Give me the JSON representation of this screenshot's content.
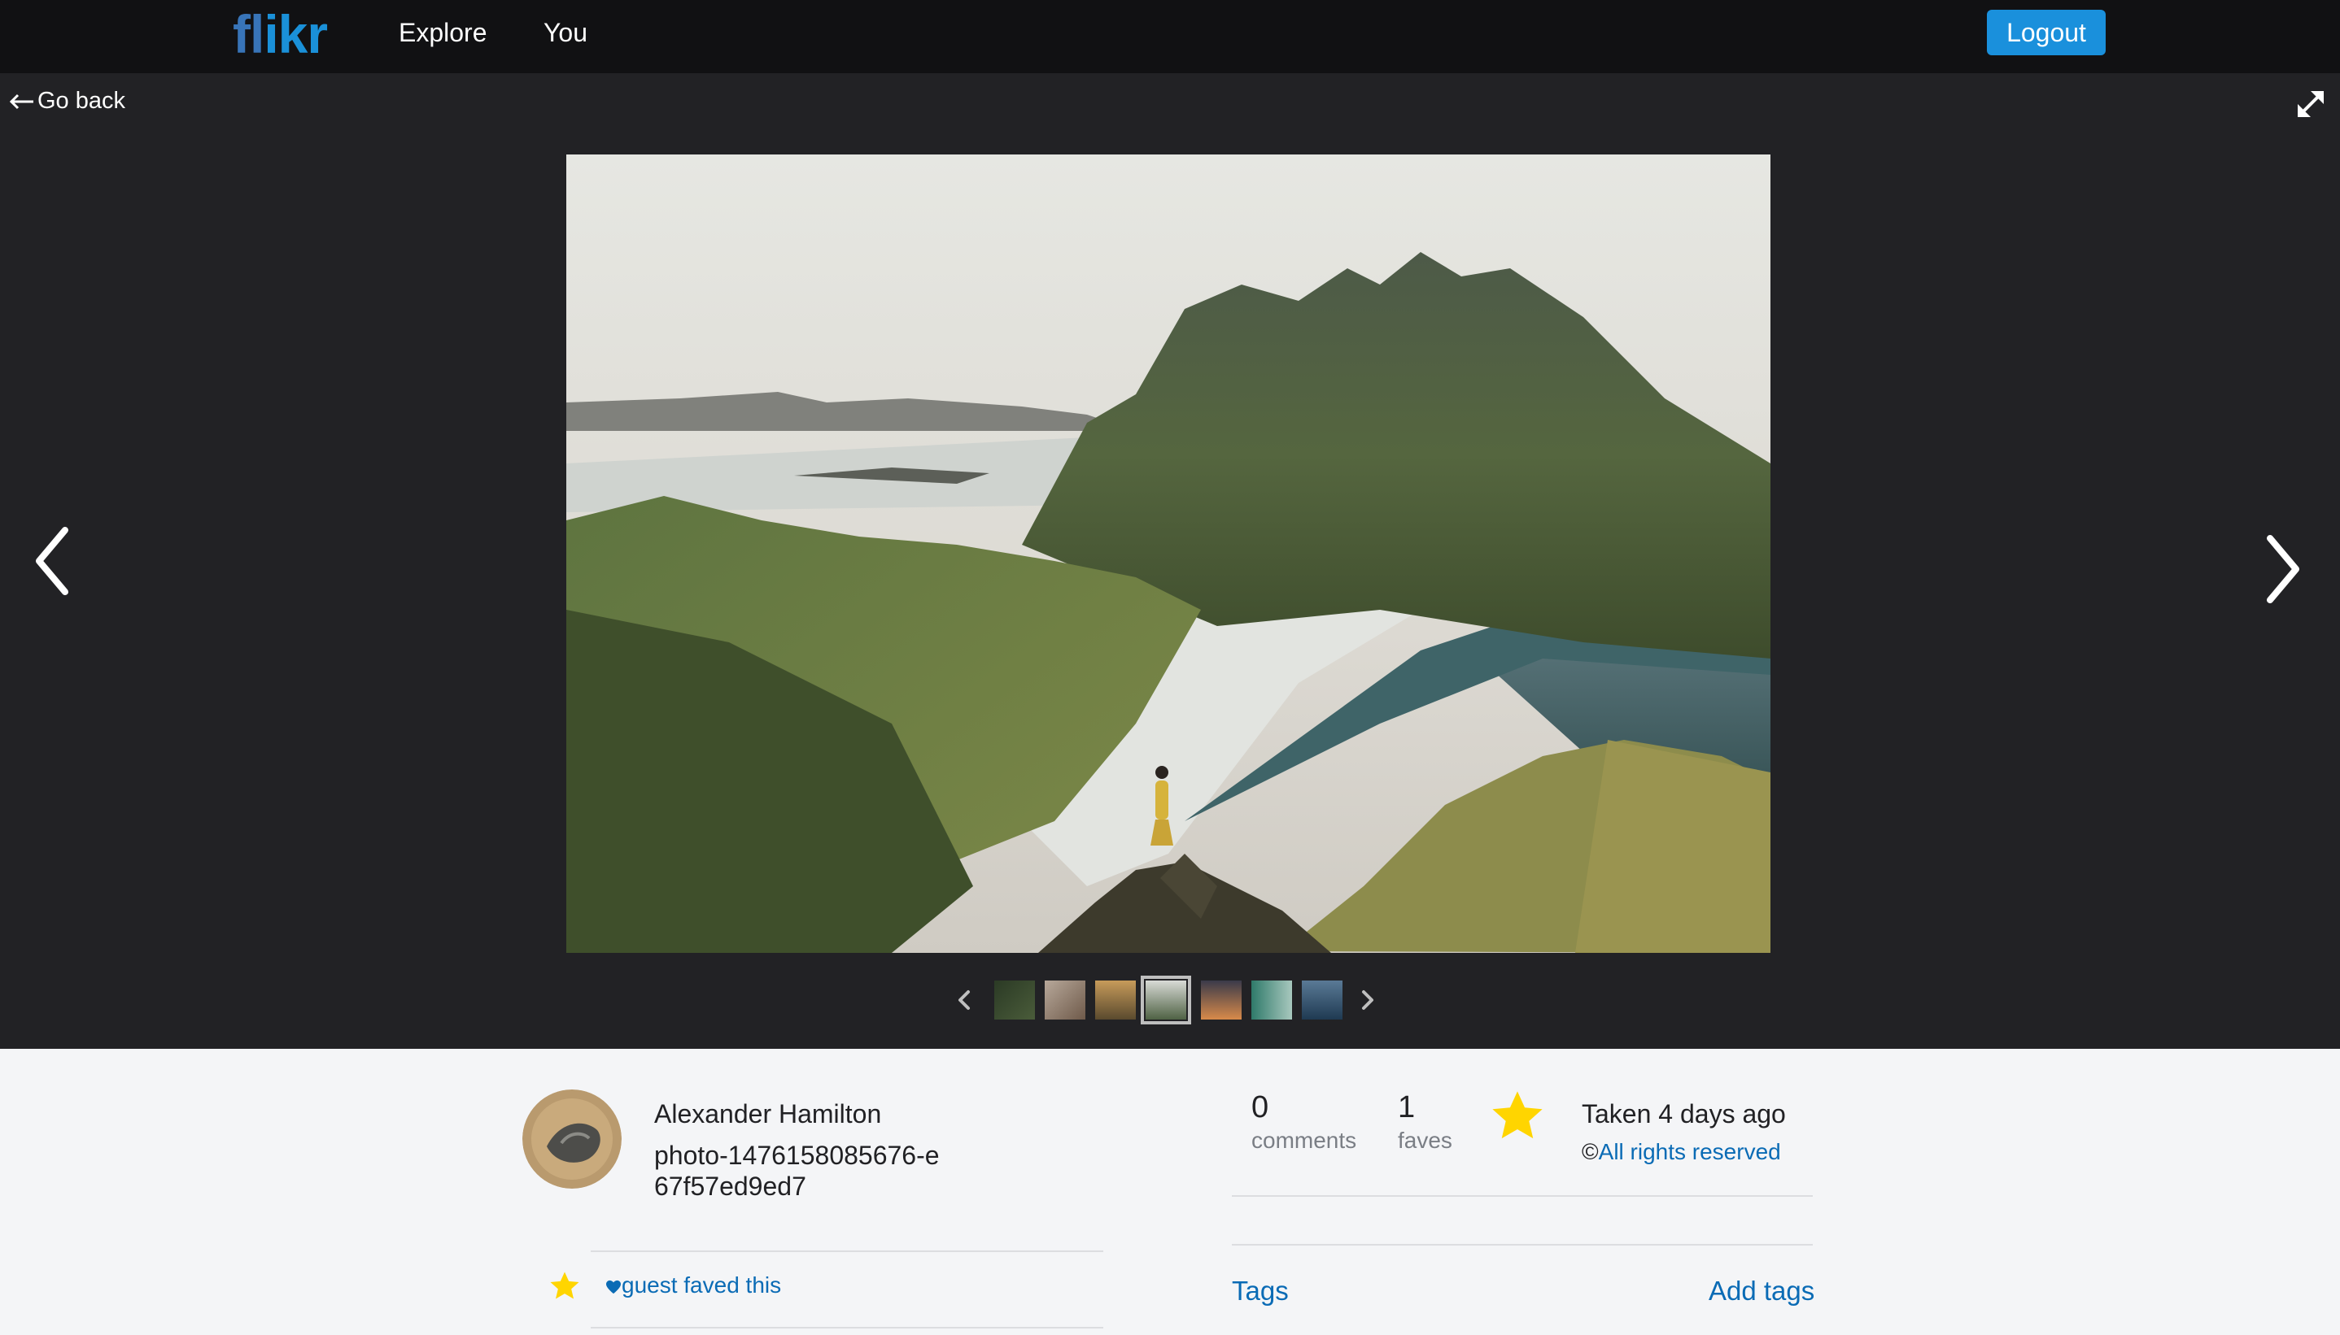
{
  "brand": {
    "logo_part1": "fl",
    "logo_part2": "ikr"
  },
  "nav": {
    "explore": "Explore",
    "you": "You",
    "logout": "Logout"
  },
  "viewer": {
    "go_back": "Go back",
    "thumbnails": [
      "forest",
      "room",
      "landscape",
      "mountains",
      "sunset",
      "teal",
      "lake"
    ],
    "active_thumbnail": "mountains"
  },
  "photo": {
    "owner": "Alexander Hamilton",
    "title": "photo-1476158085676-e67f57ed9ed7",
    "comments_count": "0",
    "comments_label": "comments",
    "faves_count": "1",
    "faves_label": "faves",
    "taken": "Taken 4 days ago",
    "copyright_symbol": "©",
    "rights": "All rights reserved"
  },
  "activity": {
    "faved_by": "guest faved this"
  },
  "tags": {
    "label": "Tags",
    "add": "Add tags"
  },
  "colors": {
    "topnav": "#111113",
    "stage": "#222225",
    "accent": "#1a90dc",
    "link": "#0a6bb5",
    "star": "#ffd500",
    "page": "#f4f5f7"
  },
  "icons": [
    "back-arrow-icon",
    "expand-icon",
    "chevron-left-icon",
    "chevron-right-icon",
    "star-icon",
    "heart-icon"
  ]
}
